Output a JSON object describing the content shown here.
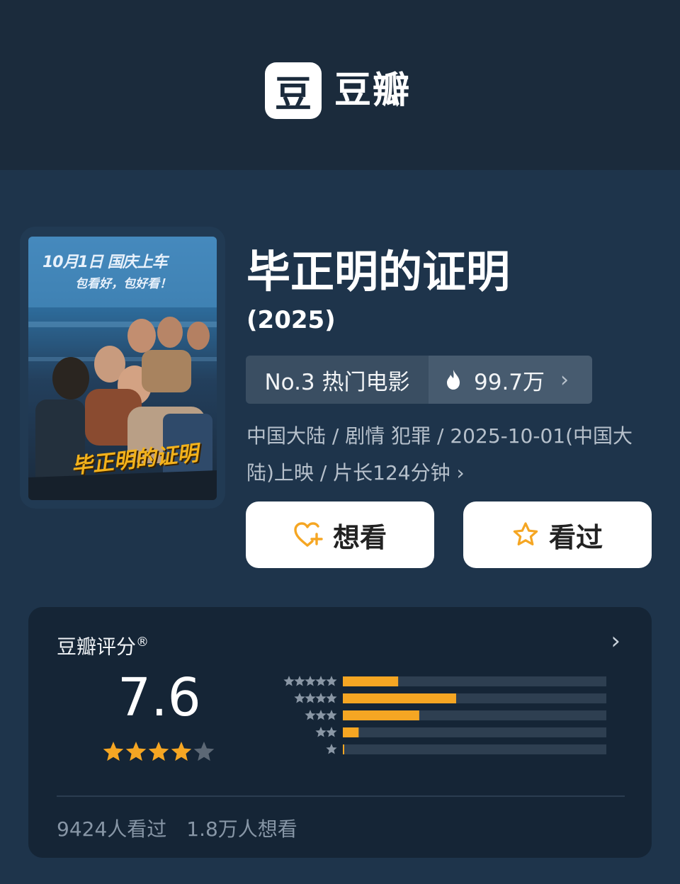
{
  "app": {
    "logo_glyph": "豆",
    "logo_text": "豆瓣"
  },
  "movie": {
    "title": "毕正明的证明",
    "year": "(2025)",
    "rank_label": "No.3 热门电影",
    "heat": "99.7万",
    "meta_line": "中国大陆 / 剧情 犯罪 / 2025-10-01(中国大陆)上映 / 片长124分钟 ›",
    "poster": {
      "top_line": "10月1日 国庆上车",
      "sub_line": "包看好，包好看！",
      "title_art": "毕正明的证明"
    }
  },
  "actions": {
    "want": "想看",
    "seen": "看过"
  },
  "rating": {
    "label": "豆瓣评分",
    "registered": "®",
    "score": "7.6",
    "stars_filled": 4,
    "stars_total": 5,
    "distribution": [
      {
        "stars": 5,
        "fraction": 0.21
      },
      {
        "stars": 4,
        "fraction": 0.43
      },
      {
        "stars": 3,
        "fraction": 0.29
      },
      {
        "stars": 2,
        "fraction": 0.06
      },
      {
        "stars": 1,
        "fraction": 0.005
      }
    ],
    "seen_count": "9424人看过",
    "want_count": "1.8万人想看"
  },
  "colors": {
    "accent": "#f5a623",
    "bar_track": "#2e3f51",
    "star_empty": "#5c6875"
  },
  "icons": {
    "hot": "flame-icon",
    "want": "heart-plus-icon",
    "seen": "star-outline-icon",
    "more": "chevron-right-icon"
  }
}
